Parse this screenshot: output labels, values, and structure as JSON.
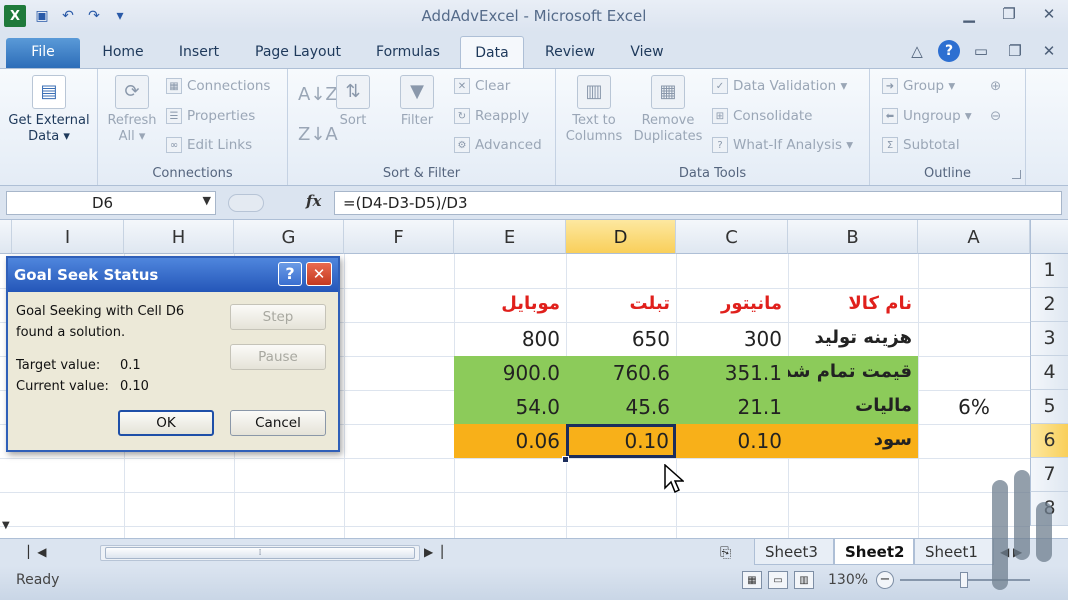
{
  "window": {
    "title": "AddAdvExcel - Microsoft Excel",
    "app_icon_letter": "X"
  },
  "tabs": {
    "file": "File",
    "home": "Home",
    "insert": "Insert",
    "page_layout": "Page Layout",
    "formulas": "Formulas",
    "data": "Data",
    "review": "Review",
    "view": "View",
    "help": "?"
  },
  "ribbon": {
    "get_external_data": {
      "line1": "Get External",
      "line2": "Data ▾"
    },
    "connections_group": {
      "label": "Connections",
      "refresh_line1": "Refresh",
      "refresh_line2": "All ▾",
      "connections": "Connections",
      "properties": "Properties",
      "edit_links": "Edit Links"
    },
    "sort_filter_group": {
      "label": "Sort & Filter",
      "sort": "Sort",
      "filter": "Filter",
      "clear": "Clear",
      "reapply": "Reapply",
      "advanced": "Advanced",
      "az_glyph": "A↓Z",
      "za_glyph": "Z↓A"
    },
    "data_tools_group": {
      "label": "Data Tools",
      "text_to_columns_line1": "Text to",
      "text_to_columns_line2": "Columns",
      "remove_duplicates_line1": "Remove",
      "remove_duplicates_line2": "Duplicates",
      "data_validation": "Data Validation ▾",
      "consolidate": "Consolidate",
      "what_if": "What-If Analysis ▾"
    },
    "outline_group": {
      "label": "Outline",
      "group": "Group ▾",
      "ungroup": "Ungroup ▾",
      "subtotal": "Subtotal"
    }
  },
  "formula_bar": {
    "name_box": "D6",
    "fx": "fx",
    "formula": "=(D4-D3-D5)/D3"
  },
  "columns": [
    "I",
    "H",
    "G",
    "F",
    "E",
    "D",
    "C",
    "B",
    "A"
  ],
  "rows": [
    "1",
    "2",
    "3",
    "4",
    "5",
    "6",
    "7",
    "8"
  ],
  "cells": {
    "B2": "نام کالا",
    "C2": "مانیتور",
    "D2": "تبلت",
    "E2": "موبایل",
    "B3": "هزینه تولید",
    "C3": "300",
    "D3": "650",
    "E3": "800",
    "B4": "قیمت تمام شده",
    "C4": "351.1",
    "D4": "760.6",
    "E4": "900.0",
    "A5": "6%",
    "B5": "مالیات",
    "C5": "21.1",
    "D5": "45.6",
    "E5": "54.0",
    "B6": "سود",
    "C6": "0.10",
    "D6": "0.10",
    "E6": "0.06"
  },
  "sheet_tabs": [
    "Sheet3",
    "Sheet2",
    "Sheet1"
  ],
  "active_sheet": "Sheet2",
  "status": {
    "ready": "Ready",
    "zoom": "130%"
  },
  "dialog": {
    "title": "Goal Seek Status",
    "line1": "Goal Seeking with Cell D6",
    "line2": "found a solution.",
    "target_label": "Target value:",
    "target_value": "0.1",
    "current_label": "Current value:",
    "current_value": "0.10",
    "step": "Step",
    "pause": "Pause",
    "ok": "OK",
    "cancel": "Cancel"
  },
  "colors": {
    "green_fill": "#8ccb5a",
    "orange_fill": "#f8b019",
    "header_red": "#e0201c",
    "selection_header": "#f9cf5a"
  }
}
